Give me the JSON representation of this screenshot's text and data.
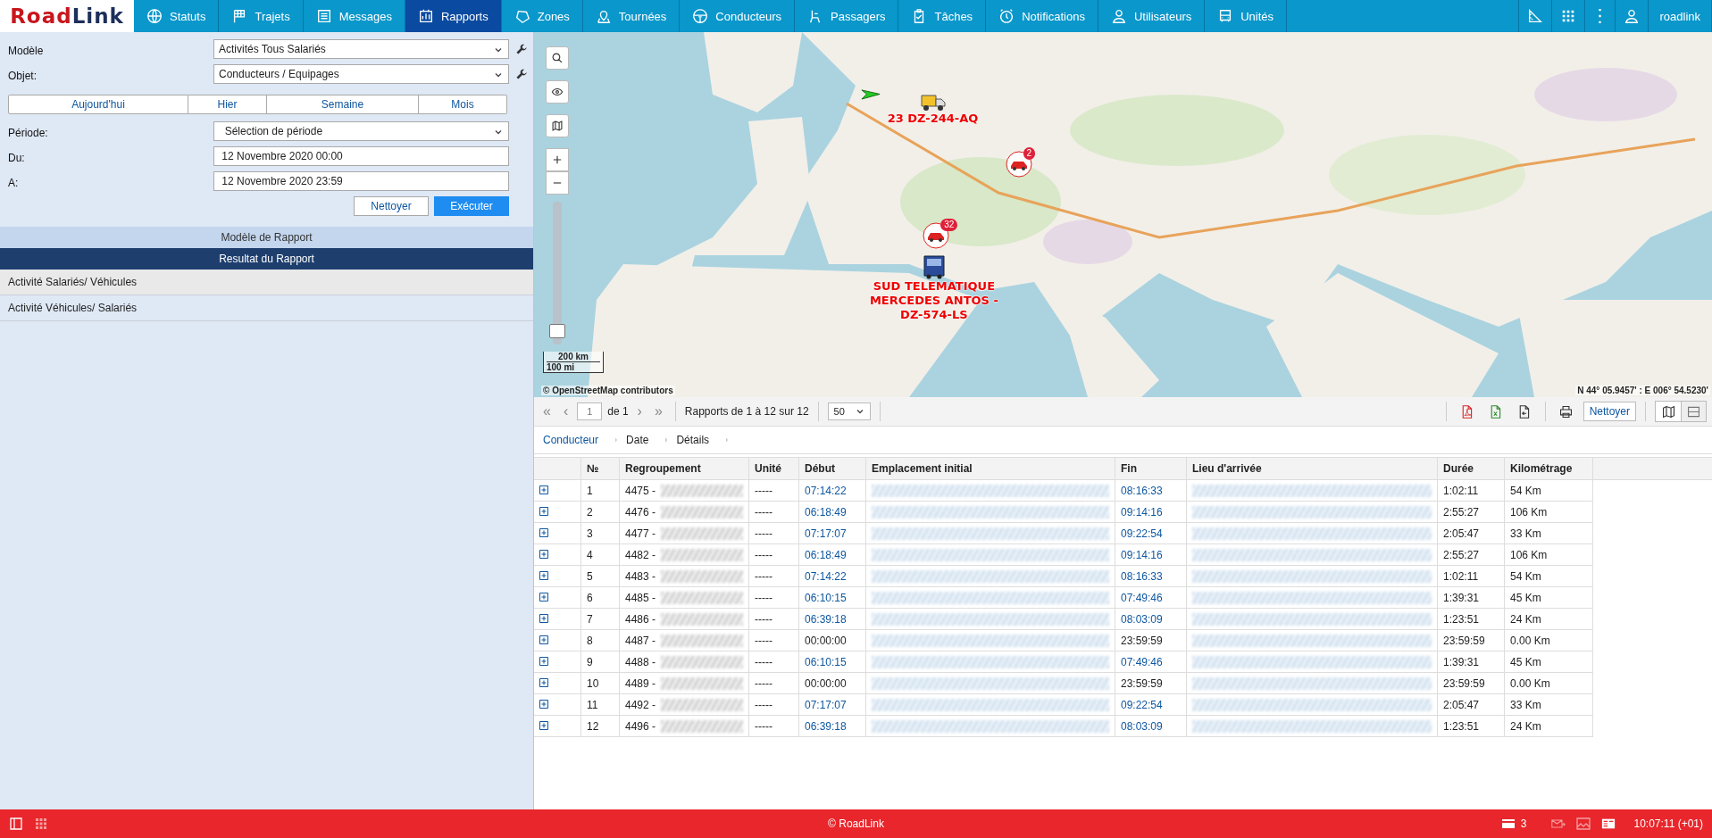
{
  "header": {
    "logo_parts": [
      "Road",
      "Link"
    ],
    "user": "roadlink"
  },
  "nav": [
    {
      "label": "Statuts",
      "selected": false
    },
    {
      "label": "Trajets",
      "selected": false
    },
    {
      "label": "Messages",
      "selected": false
    },
    {
      "label": "Rapports",
      "selected": true
    },
    {
      "label": "Zones",
      "selected": false
    },
    {
      "label": "Tournées",
      "selected": false
    },
    {
      "label": "Conducteurs",
      "selected": false
    },
    {
      "label": "Passagers",
      "selected": false
    },
    {
      "label": "Tâches",
      "selected": false
    },
    {
      "label": "Notifications",
      "selected": false
    },
    {
      "label": "Utilisateurs",
      "selected": false
    },
    {
      "label": "Unités",
      "selected": false
    }
  ],
  "form": {
    "fields": [
      {
        "label": "Modèle",
        "value": "Activités Tous Salariés",
        "kind": "select"
      },
      {
        "label": "Objet:",
        "value": "Conducteurs / Equipages",
        "kind": "select"
      }
    ],
    "range_buttons": [
      "Aujourd'hui",
      "Hier",
      "Semaine",
      "Mois"
    ],
    "period_fields": [
      {
        "label": "Période:",
        "value": "Sélection de période",
        "kind": "select"
      },
      {
        "label": "Du:",
        "value": "12 Novembre 2020 00:00",
        "kind": "text"
      },
      {
        "label": "A:",
        "value": "12 Novembre 2020 23:59",
        "kind": "text"
      }
    ],
    "clear_button": "Nettoyer",
    "run_button": "Exécuter"
  },
  "sections": [
    {
      "label": "Modèle de Rapport",
      "selected": false
    },
    {
      "label": "Resultat du Rapport",
      "selected": true
    }
  ],
  "report_items": [
    {
      "label": "Activité Salariés/ Véhicules",
      "selected": true
    },
    {
      "label": "Activité Véhicules/ Salariés",
      "selected": false
    }
  ],
  "map": {
    "markers": [
      {
        "kind": "truck",
        "label": "23 DZ-244-AQ"
      },
      {
        "kind": "car",
        "count": "2"
      },
      {
        "kind": "car",
        "count": "32"
      },
      {
        "kind": "bus",
        "label": "SUD TELEMATIQUE\nMERCEDES ANTOS -\nDZ-574-LS"
      }
    ],
    "zoom": {
      "level": 0.05
    },
    "scale": [
      "200 km",
      "100 mi"
    ],
    "attribution": "© OpenStreetMap contributors",
    "coordinates": "N 44° 05.9457' : E 006° 54.5230'"
  },
  "toolbar": {
    "first": "«",
    "prev": "‹",
    "page": "1",
    "page_total": "de 1",
    "next": "›",
    "last": "»",
    "summary": "Rapports de 1 à 12 sur 12",
    "page_size": "50",
    "clear_button": "Nettoyer"
  },
  "breadcrumb": [
    {
      "label": "Conducteur",
      "link": true
    },
    {
      "label": "Date",
      "link": false
    },
    {
      "label": "Détails",
      "link": false
    }
  ],
  "table": {
    "columns": [
      "№",
      "Regroupement",
      "Unité",
      "Début",
      "Emplacement initial",
      "Fin",
      "Lieu d'arrivée",
      "Durée",
      "Kilométrage"
    ],
    "rows": [
      {
        "num": "1",
        "group": "4475 -",
        "unit": "-----",
        "start": "07:14:22",
        "start_link": true,
        "end": "08:16:33",
        "end_link": true,
        "duration": "1:02:11",
        "km": "54 Km"
      },
      {
        "num": "2",
        "group": "4476 -",
        "unit": "-----",
        "start": "06:18:49",
        "start_link": true,
        "end": "09:14:16",
        "end_link": true,
        "duration": "2:55:27",
        "km": "106 Km"
      },
      {
        "num": "3",
        "group": "4477 -",
        "unit": "-----",
        "start": "07:17:07",
        "start_link": true,
        "end": "09:22:54",
        "end_link": true,
        "duration": "2:05:47",
        "km": "33 Km"
      },
      {
        "num": "4",
        "group": "4482 -",
        "unit": "-----",
        "start": "06:18:49",
        "start_link": true,
        "end": "09:14:16",
        "end_link": true,
        "duration": "2:55:27",
        "km": "106 Km"
      },
      {
        "num": "5",
        "group": "4483 -",
        "unit": "-----",
        "start": "07:14:22",
        "start_link": true,
        "end": "08:16:33",
        "end_link": true,
        "duration": "1:02:11",
        "km": "54 Km"
      },
      {
        "num": "6",
        "group": "4485 -",
        "unit": "-----",
        "start": "06:10:15",
        "start_link": true,
        "end": "07:49:46",
        "end_link": true,
        "duration": "1:39:31",
        "km": "45 Km"
      },
      {
        "num": "7",
        "group": "4486 -",
        "unit": "-----",
        "start": "06:39:18",
        "start_link": true,
        "end": "08:03:09",
        "end_link": true,
        "duration": "1:23:51",
        "km": "24 Km"
      },
      {
        "num": "8",
        "group": "4487 -",
        "unit": "-----",
        "start": "00:00:00",
        "start_link": false,
        "end": "23:59:59",
        "end_link": false,
        "duration": "23:59:59",
        "km": "0.00 Km"
      },
      {
        "num": "9",
        "group": "4488 -",
        "unit": "-----",
        "start": "06:10:15",
        "start_link": true,
        "end": "07:49:46",
        "end_link": true,
        "duration": "1:39:31",
        "km": "45 Km"
      },
      {
        "num": "10",
        "group": "4489 -",
        "unit": "-----",
        "start": "00:00:00",
        "start_link": false,
        "end": "23:59:59",
        "end_link": false,
        "duration": "23:59:59",
        "km": "0.00 Km"
      },
      {
        "num": "11",
        "group": "4492 -",
        "unit": "-----",
        "start": "07:17:07",
        "start_link": true,
        "end": "09:22:54",
        "end_link": true,
        "duration": "2:05:47",
        "km": "33 Km"
      },
      {
        "num": "12",
        "group": "4496 -",
        "unit": "-----",
        "start": "06:39:18",
        "start_link": true,
        "end": "08:03:09",
        "end_link": true,
        "duration": "1:23:51",
        "km": "24 Km"
      }
    ]
  },
  "footer": {
    "copyright": "© RoadLink",
    "message_count": "3",
    "time": "10:07:11 (+01)"
  }
}
